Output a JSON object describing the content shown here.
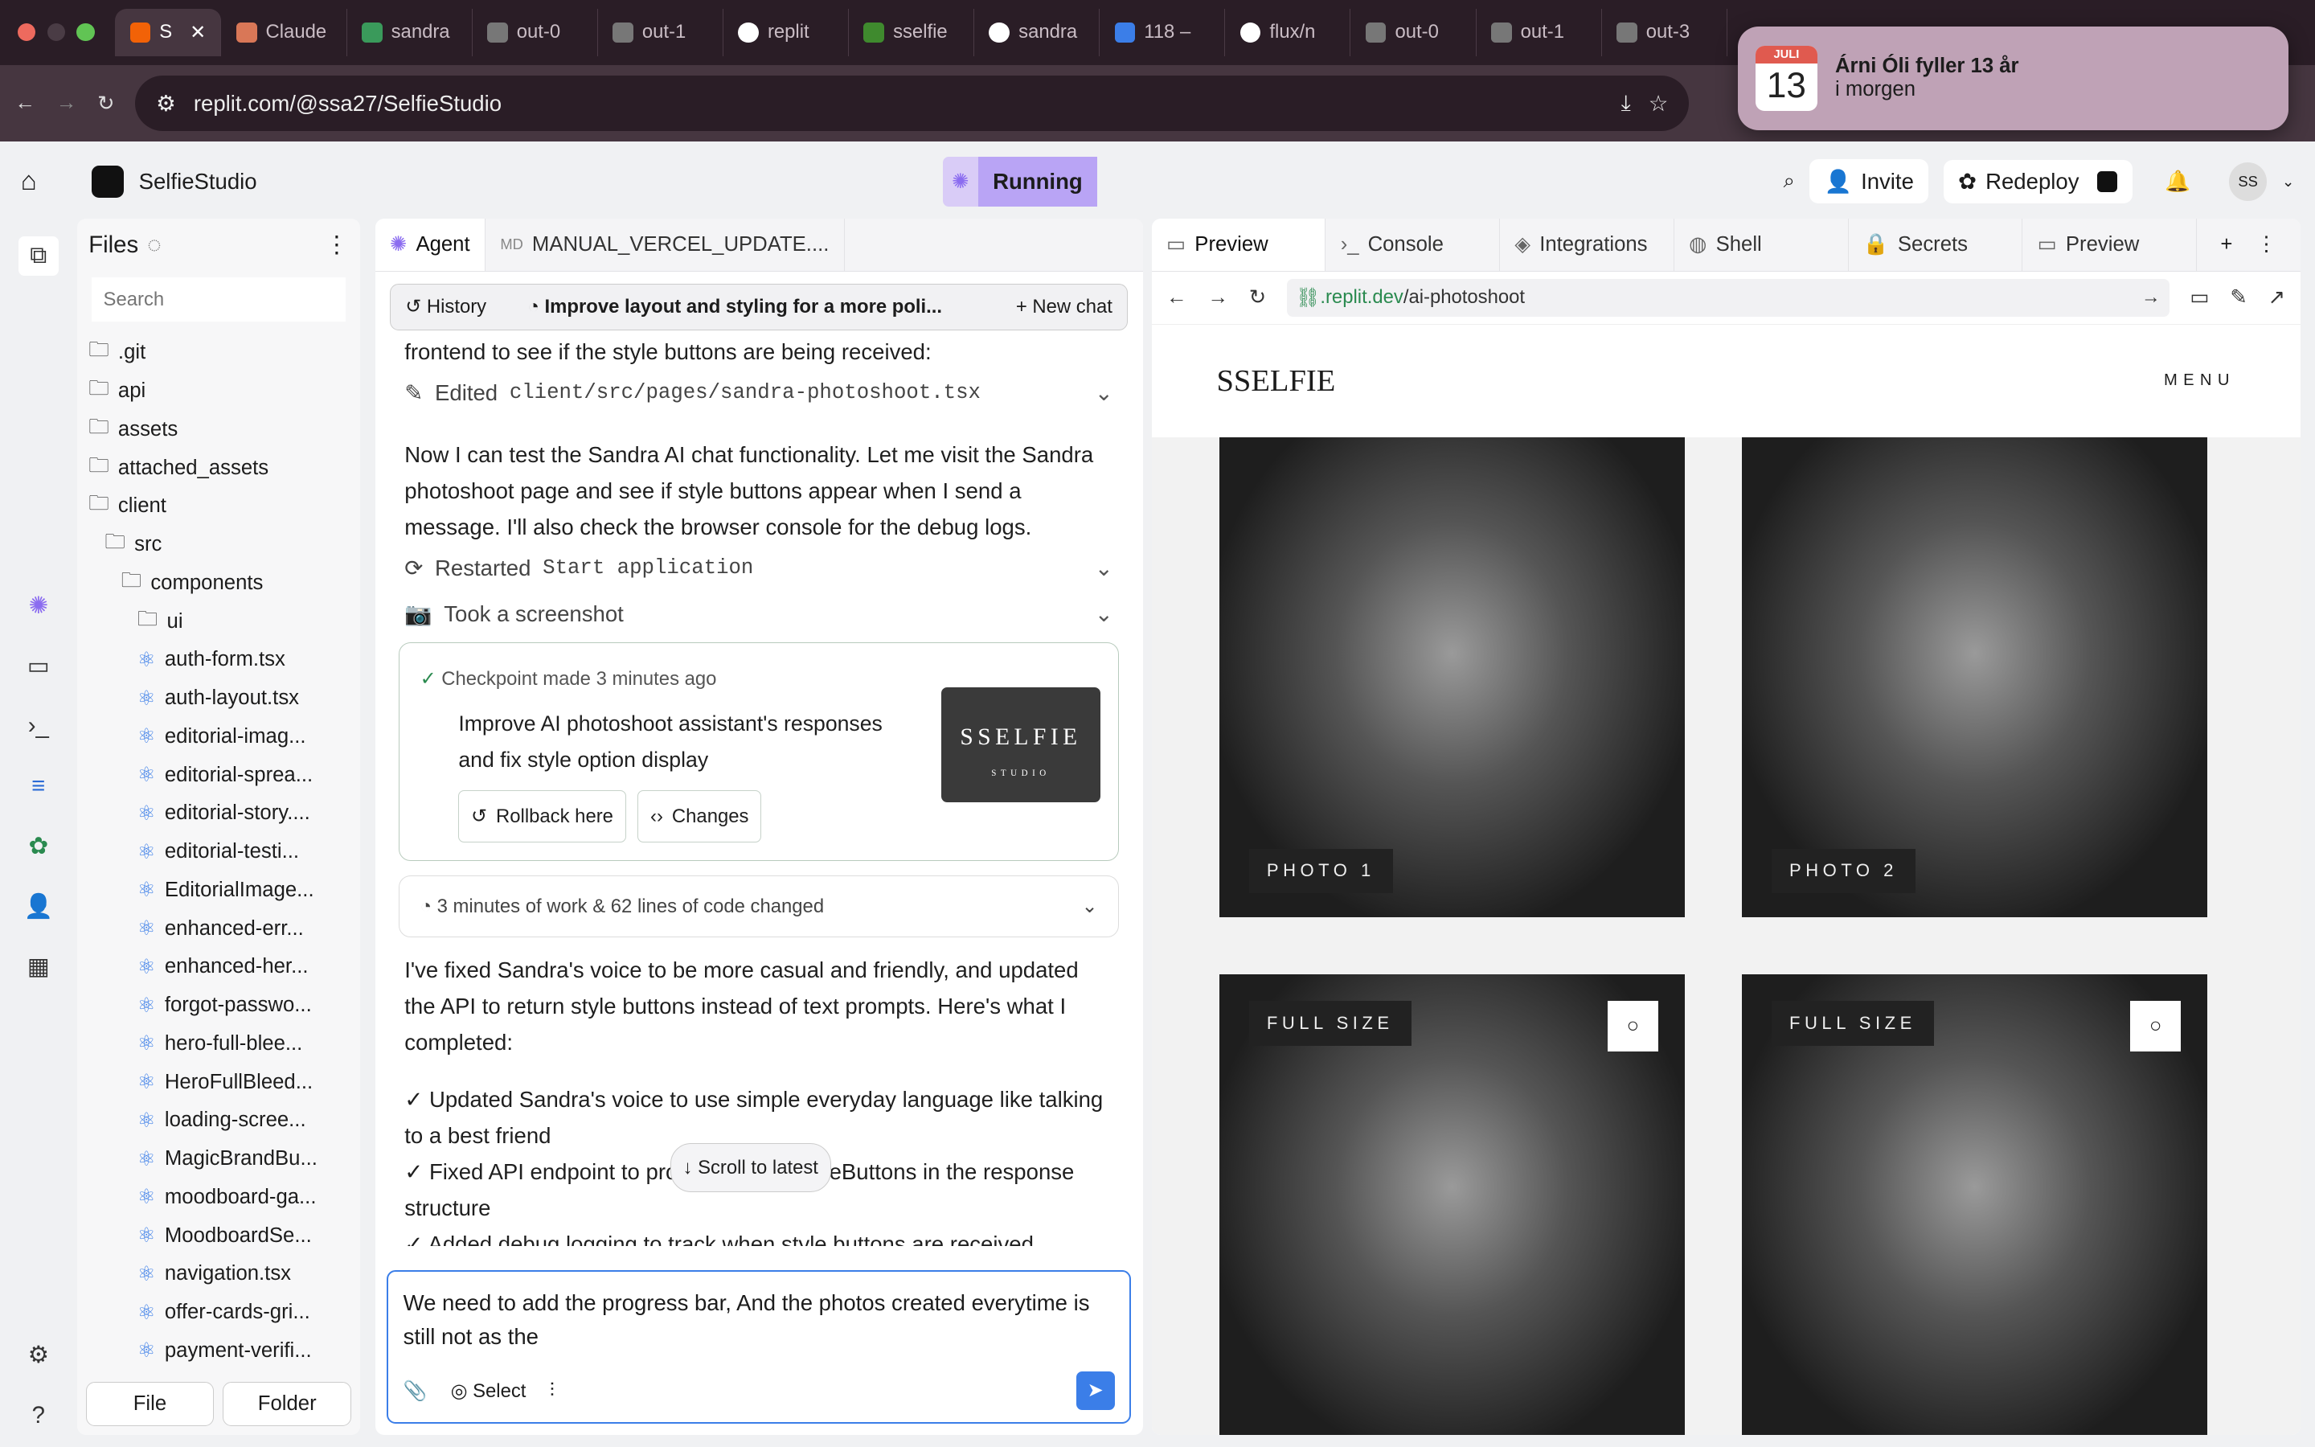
{
  "browser": {
    "tabs": [
      "S",
      "Claude",
      "sandra",
      "out-0",
      "out-1",
      "replit",
      "sselfie",
      "sandra",
      "118 –",
      "flux/n",
      "out-0",
      "out-1",
      "out-3"
    ],
    "url": "replit.com/@ssa27/SelfieStudio"
  },
  "notification": {
    "month": "JULI",
    "day": "13",
    "title": "Árni Óli fyller 13 år",
    "subtitle": "i morgen"
  },
  "topbar": {
    "project": "SelfieStudio",
    "status": "Running",
    "invite": "Invite",
    "redeploy": "Redeploy",
    "avatar": "SS"
  },
  "files": {
    "title": "Files",
    "search_placeholder": "Search",
    "items": [
      ".git",
      "api",
      "assets",
      "attached_assets",
      "client",
      "src",
      "components",
      "ui",
      "auth-form.tsx",
      "auth-layout.tsx",
      "editorial-imag...",
      "editorial-sprea...",
      "editorial-story....",
      "editorial-testi...",
      "EditorialImage...",
      "enhanced-err...",
      "enhanced-her...",
      "forgot-passwo...",
      "hero-full-blee...",
      "HeroFullBleed...",
      "loading-scree...",
      "MagicBrandBu...",
      "moodboard-ga...",
      "MoodboardSe...",
      "navigation.tsx",
      "offer-cards-gri...",
      "payment-verifi..."
    ],
    "file_button": "File",
    "folder_button": "Folder"
  },
  "agent": {
    "tab_agent": "Agent",
    "tab_file": "MANUAL_VERCEL_UPDATE....",
    "history": "History",
    "chat_title": "Improve layout and styling for a more poli...",
    "new_chat": "New chat",
    "msg0": "frontend to see if the style buttons are being received:",
    "edited_label": "Edited",
    "edited_path": "client/src/pages/sandra-photoshoot.tsx",
    "msg1": "Now I can test the Sandra AI chat functionality. Let me visit the Sandra photoshoot page and see if style buttons appear when I send a message. I'll also check the browser console for the debug logs.",
    "restarted_label": "Restarted",
    "restarted_name": "Start application",
    "screenshot": "Took a screenshot",
    "checkpoint": "Checkpoint made",
    "checkpoint_time": "3 minutes ago",
    "checkpoint_desc": "Improve AI photoshoot assistant's responses and fix style option display",
    "thumb_title": "SSELFIE",
    "thumb_sub": "STUDIO",
    "rollback": "Rollback here",
    "changes": "Changes",
    "work_summary": "3 minutes of work & 62 lines of code changed",
    "msg2": "I've fixed Sandra's voice to be more casual and friendly, and updated the API to return style buttons instead of text prompts. Here's what I completed:",
    "bullets": [
      "✓ Updated Sandra's voice to use simple everyday language like talking to a best friend",
      "✓ Fixed API endpoint to properly return styleButtons in the response structure",
      "✓ Added debug logging to track when style buttons are received"
    ],
    "scroll_latest": "Scroll to latest",
    "input_value": "We need to add the progress bar, And the photos created everytime is still not as the ",
    "select": "Select"
  },
  "preview": {
    "tabs": [
      "Preview",
      "Console",
      "Integrations",
      "Shell",
      "Secrets",
      "Preview"
    ],
    "url_domain": ".replit.dev",
    "url_path": "/ai-photoshoot",
    "site_logo": "SSELFIE",
    "site_menu": "MENU",
    "photo_labels": [
      "PHOTO 1",
      "PHOTO 2",
      "FULL SIZE",
      "FULL SIZE"
    ]
  }
}
